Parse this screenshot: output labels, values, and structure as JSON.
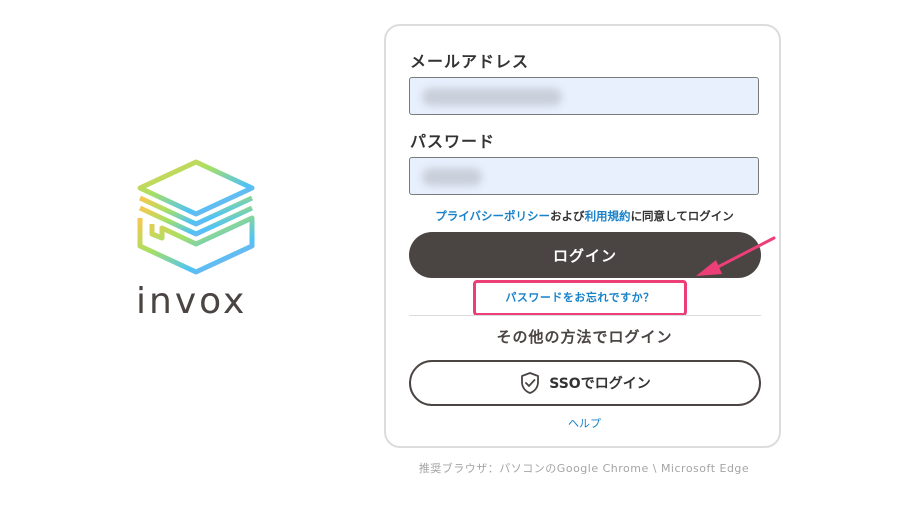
{
  "brand": {
    "name": "invox",
    "logo_icon": "stacked-layers-icon",
    "logo_gradient": [
      "#f9c74f",
      "#a8e063",
      "#4fc3f7",
      "#b39ddb"
    ]
  },
  "login_form": {
    "email_label": "メールアドレス",
    "email_value": "",
    "password_label": "パスワード",
    "password_value": "",
    "consent": {
      "privacy_link": "プライバシーポリシー",
      "and": "および",
      "terms_link": "利用規約",
      "suffix": "に同意してログイン"
    },
    "login_button": "ログイン",
    "forgot_password": "パスワードをお忘れですか？",
    "other_methods_heading": "その他の方法でログイン",
    "sso_icon": "shield-check-icon",
    "sso_button": "SSOでログイン",
    "help_link": "ヘルプ"
  },
  "footer": {
    "browser_note": "推奨ブラウザ：パソコンのGoogle Chrome \\ Microsoft Edge"
  },
  "annotation": {
    "highlight_color": "#ec3f77",
    "arrow_icon": "pointer-arrow-icon"
  },
  "colors": {
    "primary_dark": "#4a4442",
    "link_blue": "#1a82c9",
    "input_bg": "#e8f0fe"
  }
}
